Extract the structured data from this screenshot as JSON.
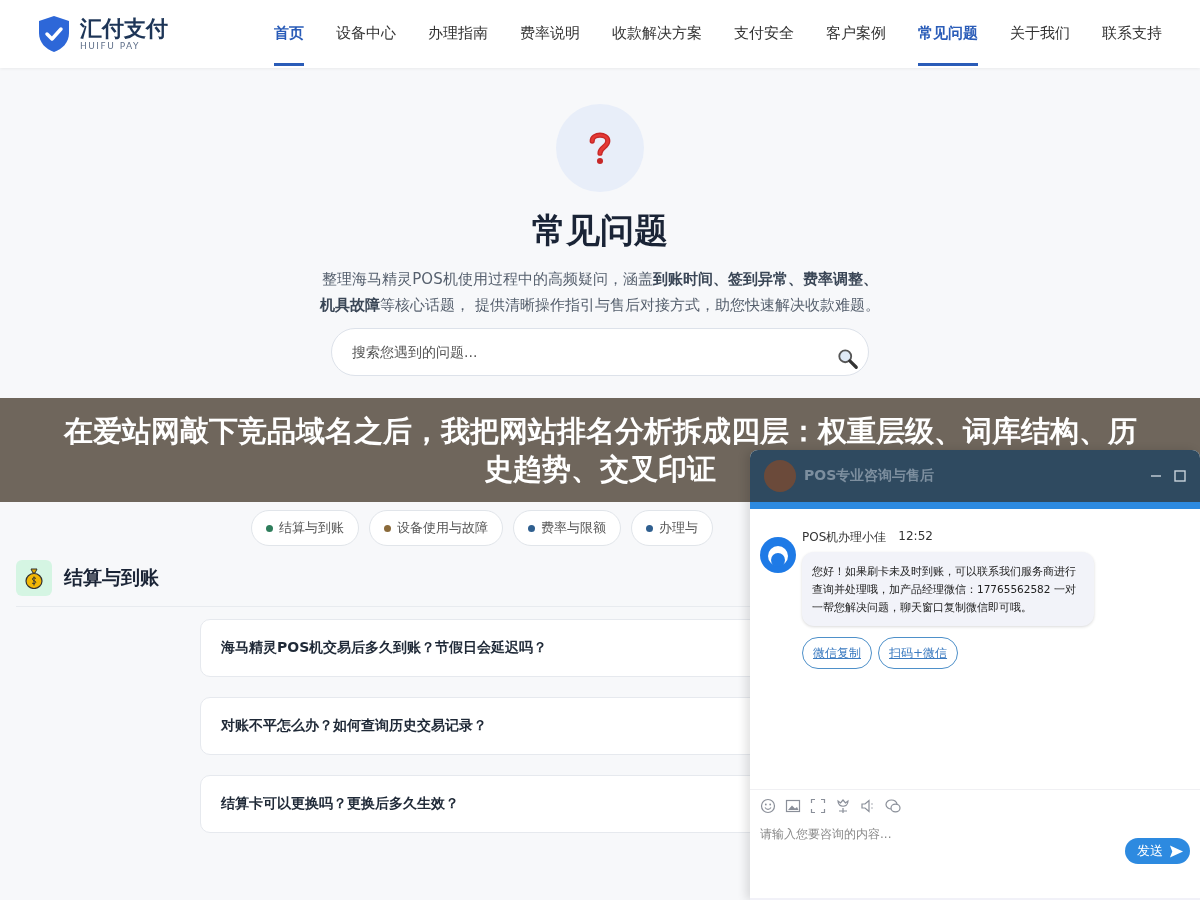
{
  "header": {
    "logo_name": "汇付支付",
    "logo_sub": "HUIFU PAY",
    "nav": [
      {
        "label": "首页",
        "selected": true
      },
      {
        "label": "设备中心",
        "selected": false
      },
      {
        "label": "办理指南",
        "selected": false
      },
      {
        "label": "费率说明",
        "selected": false
      },
      {
        "label": "收款解决方案",
        "selected": false
      },
      {
        "label": "支付安全",
        "selected": false
      },
      {
        "label": "客户案例",
        "selected": false
      },
      {
        "label": "常见问题",
        "selected": true
      },
      {
        "label": "关于我们",
        "selected": false
      },
      {
        "label": "联系支持",
        "selected": false
      }
    ]
  },
  "hero": {
    "title": "常见问题",
    "description": "整理海马精灵POS机使用过程中的高频疑问，涵盖**到账时间、签到异常、费率调整、机具故障**等核心话题， 提供清晰操作指引与售后对接方式，助您快速解决收款难题。",
    "search": {
      "placeholder": "搜索您遇到的问题..."
    }
  },
  "categories": [
    {
      "label": "结算与到账",
      "color": "#2e7d5b"
    },
    {
      "label": "设备使用与故障",
      "color": "#8a6a3a"
    },
    {
      "label": "费率与限额",
      "color": "#2f5f8f"
    },
    {
      "label": "办理与",
      "color": "#2f5f8f"
    }
  ],
  "sections": [
    {
      "title": "结算与到账",
      "questions": [
        "海马精灵POS机交易后多久到账？节假日会延迟吗？",
        "对账不平怎么办？如何查询历史交易记录？",
        "结算卡可以更换吗？更换后多久生效？"
      ]
    }
  ],
  "banner": {
    "text": "在爱站网敲下竞品域名之后，我把网站排名分析拆成四层：权重层级、词库结构、历史趋势、交叉印证"
  },
  "chat": {
    "title": "POS专业咨询与售后",
    "messages": [
      {
        "sender": "POS机办理小佳",
        "time": "12:52",
        "text": "您好！如果刷卡未及时到账，可以联系我们服务商进行查询并处理哦，加产品经理微信：17765562582 一对一帮您解决问题，聊天窗口复制微信即可哦。",
        "actions": [
          "微信复制",
          "扫码+微信"
        ]
      }
    ],
    "input": {
      "placeholder": "请输入您要咨询的内容..."
    },
    "send": "发送"
  }
}
